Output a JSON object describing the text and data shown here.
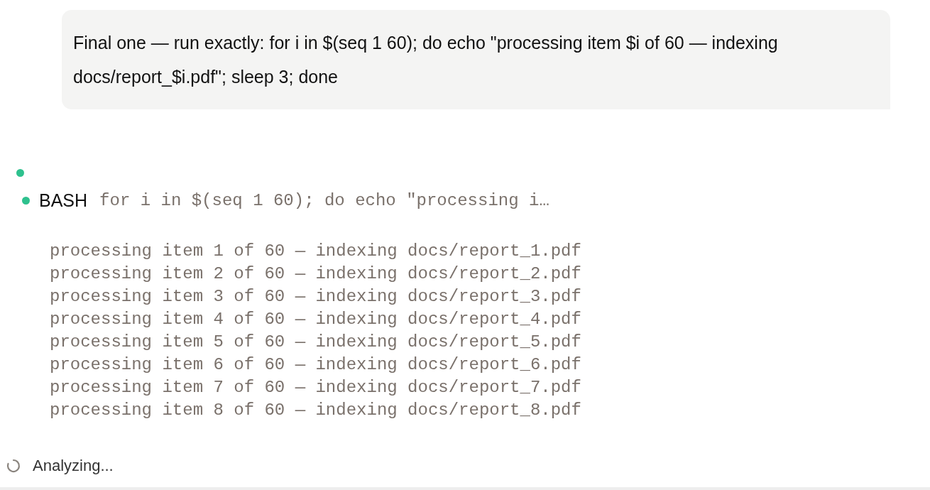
{
  "user_message": "Final one — run exactly: for i in $(seq 1 60); do echo \"processing item $i of 60 — indexing docs/report_$i.pdf\"; sleep 3; done",
  "steps": [
    {
      "kind": "empty"
    },
    {
      "kind": "tool",
      "tool": "BASH",
      "command": "for i in $(seq 1 60); do echo \"processing i…",
      "output": [
        "processing item 1 of 60 — indexing docs/report_1.pdf",
        "processing item 2 of 60 — indexing docs/report_2.pdf",
        "processing item 3 of 60 — indexing docs/report_3.pdf",
        "processing item 4 of 60 — indexing docs/report_4.pdf",
        "processing item 5 of 60 — indexing docs/report_5.pdf",
        "processing item 6 of 60 — indexing docs/report_6.pdf",
        "processing item 7 of 60 — indexing docs/report_7.pdf",
        "processing item 8 of 60 — indexing docs/report_8.pdf"
      ]
    }
  ],
  "status": "Analyzing..."
}
